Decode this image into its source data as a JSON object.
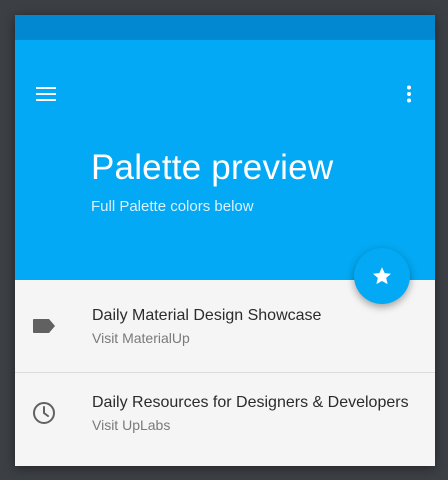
{
  "header": {
    "title": "Palette preview",
    "subtitle": "Full Palette colors below",
    "menu_icon": "menu-icon",
    "more_icon": "more-vert-icon"
  },
  "fab": {
    "icon": "star-icon"
  },
  "list": {
    "items": [
      {
        "icon": "label-icon",
        "title": "Daily Material Design Showcase",
        "subtitle": "Visit MaterialUp"
      },
      {
        "icon": "clock-icon",
        "title": "Daily Resources for Designers & Developers",
        "subtitle": "Visit UpLabs"
      }
    ]
  },
  "colors": {
    "primary": "#03a9f4",
    "primary_dark": "#0288d1",
    "background": "#3c4045",
    "surface": "#f5f5f5"
  }
}
